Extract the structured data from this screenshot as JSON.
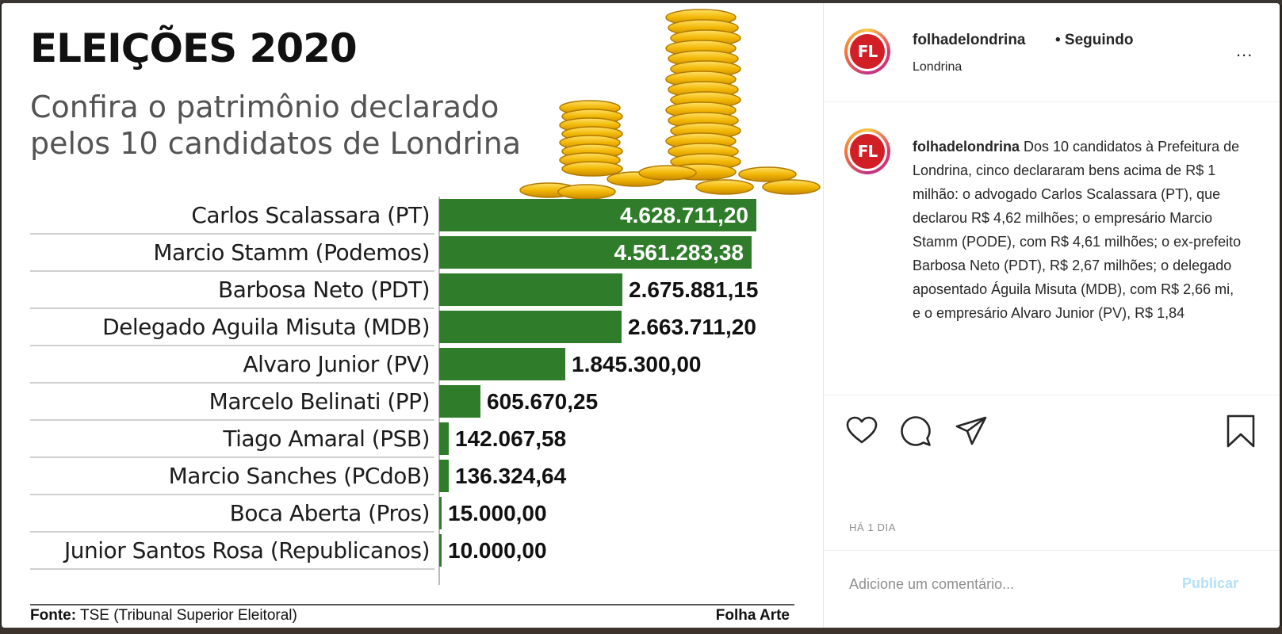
{
  "graphic": {
    "title": "ELEIÇÕES 2020",
    "subtitle": "Confira o patrimônio declarado pelos 10 candidatos de Londrina",
    "source_label": "Fonte:",
    "source_text": "TSE (Tribunal Superior Eleitoral)",
    "credit": "Folha Arte"
  },
  "chart_data": {
    "type": "bar",
    "orientation": "horizontal",
    "categories": [
      "Carlos Scalassara (PT)",
      "Marcio Stamm (Podemos)",
      "Barbosa Neto (PDT)",
      "Delegado Aguila Misuta (MDB)",
      "Alvaro Junior (PV)",
      "Marcelo Belinati (PP)",
      "Tiago Amaral (PSB)",
      "Marcio Sanches (PCdoB)",
      "Boca Aberta (Pros)",
      "Junior Santos Rosa (Republicanos)"
    ],
    "values": [
      4628711.2,
      4561283.38,
      2675881.15,
      2663711.2,
      1845300.0,
      605670.25,
      142067.58,
      136324.64,
      15000.0,
      10000.0
    ],
    "value_labels": [
      "4.628.711,20",
      "4.561.283,38",
      "2.675.881,15",
      "2.663.711,20",
      "1.845.300,00",
      "605.670,25",
      "142.067,58",
      "136.324,64",
      "15.000,00",
      "10.000,00"
    ],
    "title": "",
    "xlabel": "",
    "ylabel": "",
    "bar_color": "#2f7d2a",
    "grid": false,
    "legend": "none"
  },
  "post": {
    "username": "folhadelondrina",
    "follow_status": "• Seguindo",
    "location": "Londrina",
    "avatar_text": "FL",
    "more_label": "...",
    "caption_user": "folhadelondrina",
    "caption_text": "Dos 10 candidatos à Prefeitura de Londrina, cinco declararam bens acima de R$ 1 milhão: o advogado Carlos Scalassara (PT), que declarou R$ 4,62 milhões; o empresário Marcio Stamm (PODE), com R$ 4,61 milhões; o ex-prefeito Barbosa Neto (PDT), R$ 2,67 milhões; o delegado aposentado Águila Misuta (MDB), com R$ 2,66 mi, e o empresário Alvaro Junior (PV), R$ 1,84",
    "time": "HÁ 1 DIA",
    "comment_placeholder": "Adicione um comentário...",
    "publish_label": "Publicar",
    "brand_color": "#d21f26"
  }
}
